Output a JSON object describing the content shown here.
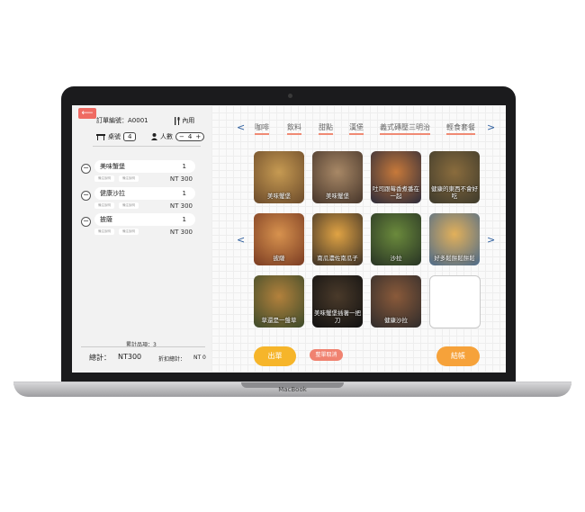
{
  "device": {
    "brand": "MacBook"
  },
  "left": {
    "back_glyph": "⟵",
    "order_no": "訂單編號：A0001",
    "dine_in": "內用",
    "table_label": "桌號",
    "table_value": "4",
    "people_label": "人數",
    "people_value": "4",
    "minus": "−",
    "plus": "+",
    "items": [
      {
        "name": "美味蟹堡",
        "qty": "1",
        "price": "NT 300",
        "tag1": "備注說明",
        "tag2": "備注說明"
      },
      {
        "name": "健康沙拉",
        "qty": "1",
        "price": "NT 300",
        "tag1": "備注說明",
        "tag2": "備注說明"
      },
      {
        "name": "披薩",
        "qty": "1",
        "price": "NT 300",
        "tag1": "備注說明",
        "tag2": "備注說明"
      }
    ],
    "total_count": "累計品項：3",
    "total_label": "總計：",
    "total_value": "NT300",
    "discount_label": "折扣總計：",
    "discount_value": "NT 0"
  },
  "menu": {
    "tabs": [
      "咖啡",
      "飲料",
      "甜點",
      "漢堡",
      "義式磚壓三明治",
      "輕食套餐"
    ],
    "arrow_left": "<",
    "arrow_right": ">",
    "cards": [
      {
        "label": "美味蟹堡",
        "colors": [
          "#6b4a2a",
          "#c69a52"
        ]
      },
      {
        "label": "美味蟹堡",
        "colors": [
          "#46352a",
          "#a88866"
        ]
      },
      {
        "label": "吐司跟莓香煮番在一起",
        "colors": [
          "#2a2a3a",
          "#c7793a"
        ]
      },
      {
        "label": "健康的東西不會好吃",
        "colors": [
          "#3d3a2c",
          "#8a6c3d"
        ]
      },
      {
        "label": "披薩",
        "colors": [
          "#7a3b22",
          "#d7924e"
        ]
      },
      {
        "label": "南瓜濃佐南瓜子",
        "colors": [
          "#3b3026",
          "#e0a344"
        ]
      },
      {
        "label": "沙拉",
        "colors": [
          "#273324",
          "#6b8a3c"
        ]
      },
      {
        "label": "好多鬆餅鬆餅鬆",
        "colors": [
          "#4b6a8a",
          "#e2b05a"
        ]
      },
      {
        "label": "草還是一盤草",
        "colors": [
          "#3b4a2a",
          "#b3813c"
        ]
      },
      {
        "label": "美味蟹堡插著一把刀",
        "colors": [
          "#111111",
          "#4a3a2a"
        ]
      },
      {
        "label": "健康沙拉",
        "colors": [
          "#2e2b2b",
          "#8a5a3a"
        ]
      }
    ],
    "order_btn": "出單",
    "cancel_btn": "整單取消",
    "checkout_btn": "結帳"
  }
}
